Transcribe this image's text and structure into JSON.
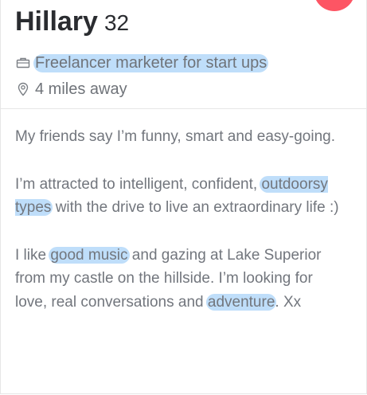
{
  "profile": {
    "name": "Hillary",
    "age": "32",
    "job": "Freelancer marketer for start ups",
    "distance": "4 miles away",
    "icons": {
      "job": "briefcase-icon",
      "location": "map-pin-icon"
    }
  },
  "bio": {
    "p1": "My friends say I’m funny, smart and easy-going.",
    "p2_pre": "I’m attracted to intelligent, confident, ",
    "p2_hl": "outdoorsy types",
    "p2_post": " with the drive to live an extraordinary life :)",
    "p3_pre": "I like ",
    "p3_hl1": "good music",
    "p3_mid": " and gazing at Lake Superior from my castle on the hillside. I’m looking for love, real conversations and ",
    "p3_hl2": "adventure",
    "p3_post": ". Xx"
  },
  "colors": {
    "highlight": "#8ac3f5",
    "badge": "#fd5564",
    "text": "#72767d"
  }
}
